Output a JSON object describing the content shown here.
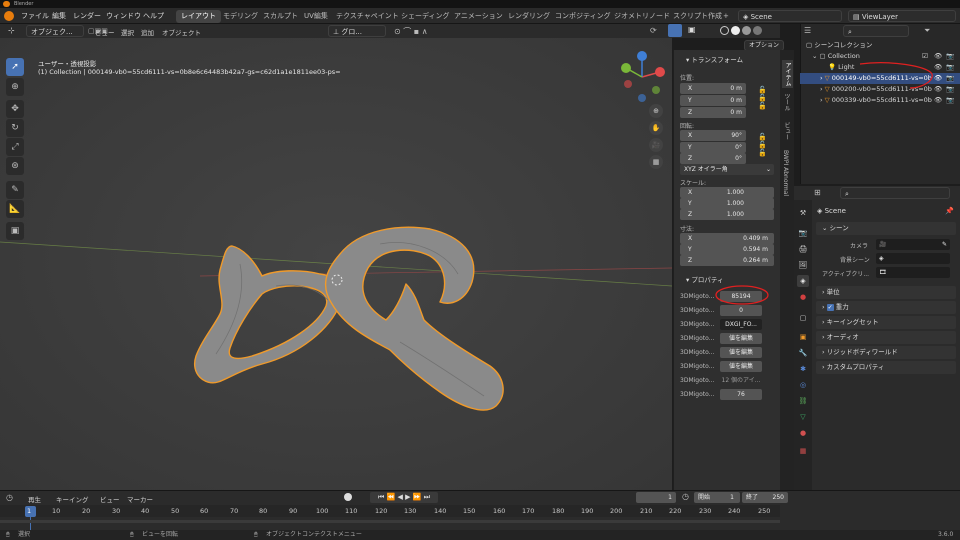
{
  "app": {
    "title": "Blender",
    "version": "3.6.0"
  },
  "menubar": {
    "items": [
      "ファイル",
      "編集",
      "レンダー",
      "ウィンドウ",
      "ヘルプ"
    ],
    "workspaces": [
      "レイアウト",
      "モデリング",
      "スカルプト",
      "UV編集",
      "テクスチャペイント",
      "シェーディング",
      "アニメーション",
      "レンダリング",
      "コンポジティング",
      "ジオメトリノード",
      "スクリプト作成"
    ],
    "add_symbol": "+",
    "scene": "Scene",
    "view_layer": "ViewLayer"
  },
  "viewport_header": {
    "mode": "オブジェク...",
    "menus": [
      "ビュー",
      "選択",
      "追加",
      "オブジェクト"
    ],
    "transform_orientation": "グロ...",
    "options": "オプション"
  },
  "viewport": {
    "view_name": "ユーザー・透視投影",
    "object_info": "(1) Collection | 000149-vb0=55cd6111-vs=0b8e6c64483b42a7-gs=c62d1a1e1811ee03-ps="
  },
  "npanel": {
    "transform_header": "トランスフォーム",
    "location_label": "位置:",
    "location": [
      {
        "axis": "X",
        "value": "0 m"
      },
      {
        "axis": "Y",
        "value": "0 m"
      },
      {
        "axis": "Z",
        "value": "0 m"
      }
    ],
    "rotation_label": "回転:",
    "rotation": [
      {
        "axis": "X",
        "value": "90°"
      },
      {
        "axis": "Y",
        "value": "0°"
      },
      {
        "axis": "Z",
        "value": "0°"
      }
    ],
    "rotation_mode": "XYZ オイラー角",
    "scale_label": "スケール:",
    "scale": [
      {
        "axis": "X",
        "value": "1.000"
      },
      {
        "axis": "Y",
        "value": "1.000"
      },
      {
        "axis": "Z",
        "value": "1.000"
      }
    ],
    "dimensions_label": "寸法:",
    "dimensions": [
      {
        "axis": "X",
        "value": "0.409 m"
      },
      {
        "axis": "Y",
        "value": "0.594 m"
      },
      {
        "axis": "Z",
        "value": "0.264 m"
      }
    ],
    "properties_header": "プロパティ",
    "properties": [
      {
        "label": "3DMigoto...",
        "value": "85194"
      },
      {
        "label": "3DMigoto...",
        "value": "0"
      },
      {
        "label": "3DMigoto...",
        "value": "DXGI_FO..."
      },
      {
        "label": "3DMigoto...",
        "value": "値を編集"
      },
      {
        "label": "3DMigoto...",
        "value": "値を編集"
      },
      {
        "label": "3DMigoto...",
        "value": "値を編集"
      },
      {
        "label": "3DMigoto...",
        "value": "12 個のアイ..."
      },
      {
        "label": "3DMigoto...",
        "value": "76"
      }
    ],
    "vertical_tabs": [
      "アイテム",
      "ツール",
      "ビュー",
      "BWPI Abnormal"
    ]
  },
  "outliner": {
    "root": "シーンコレクション",
    "items": [
      {
        "name": "Collection",
        "indent": 1
      },
      {
        "name": "Light",
        "indent": 2
      },
      {
        "name": "000149-vb0=55cd6111-vs=0b",
        "indent": 2,
        "selected": true
      },
      {
        "name": "000200-vb0=55cd6111-vs=0b",
        "indent": 2
      },
      {
        "name": "000339-vb0=55cd6111-vs=0b",
        "indent": 2
      }
    ]
  },
  "properties_editor": {
    "scene_name": "Scene",
    "scene_section": "シーン",
    "camera_label": "カメラ",
    "background_label": "背景シーン",
    "active_clip_label": "アクティブクリ...",
    "sections": [
      "単位",
      "重力",
      "キーイングセット",
      "オーディオ",
      "リジッドボディワールド",
      "カスタムプロパティ"
    ],
    "gravity_checked": true
  },
  "timeline": {
    "menus": [
      "再生",
      "キーイング",
      "ビュー",
      "マーカー"
    ],
    "current_frame": "1",
    "start_label": "開始",
    "start": "1",
    "end_label": "終了",
    "end": "250",
    "ticks": [
      "1",
      "10",
      "20",
      "30",
      "40",
      "50",
      "60",
      "70",
      "80",
      "90",
      "100",
      "110",
      "120",
      "130",
      "140",
      "150",
      "160",
      "170",
      "180",
      "190",
      "200",
      "210",
      "220",
      "230",
      "240",
      "250"
    ]
  },
  "statusbar": {
    "select": "選択",
    "rotate": "ビューを回転",
    "context_menu": "オブジェクトコンテクストメニュー"
  },
  "colors": {
    "accent": "#4772b3",
    "selection_outline": "#f09a2a",
    "annotation": "#e02020",
    "x_axis": "#e04a4a",
    "y_axis": "#7ab839",
    "z_axis": "#3f7fd6"
  }
}
